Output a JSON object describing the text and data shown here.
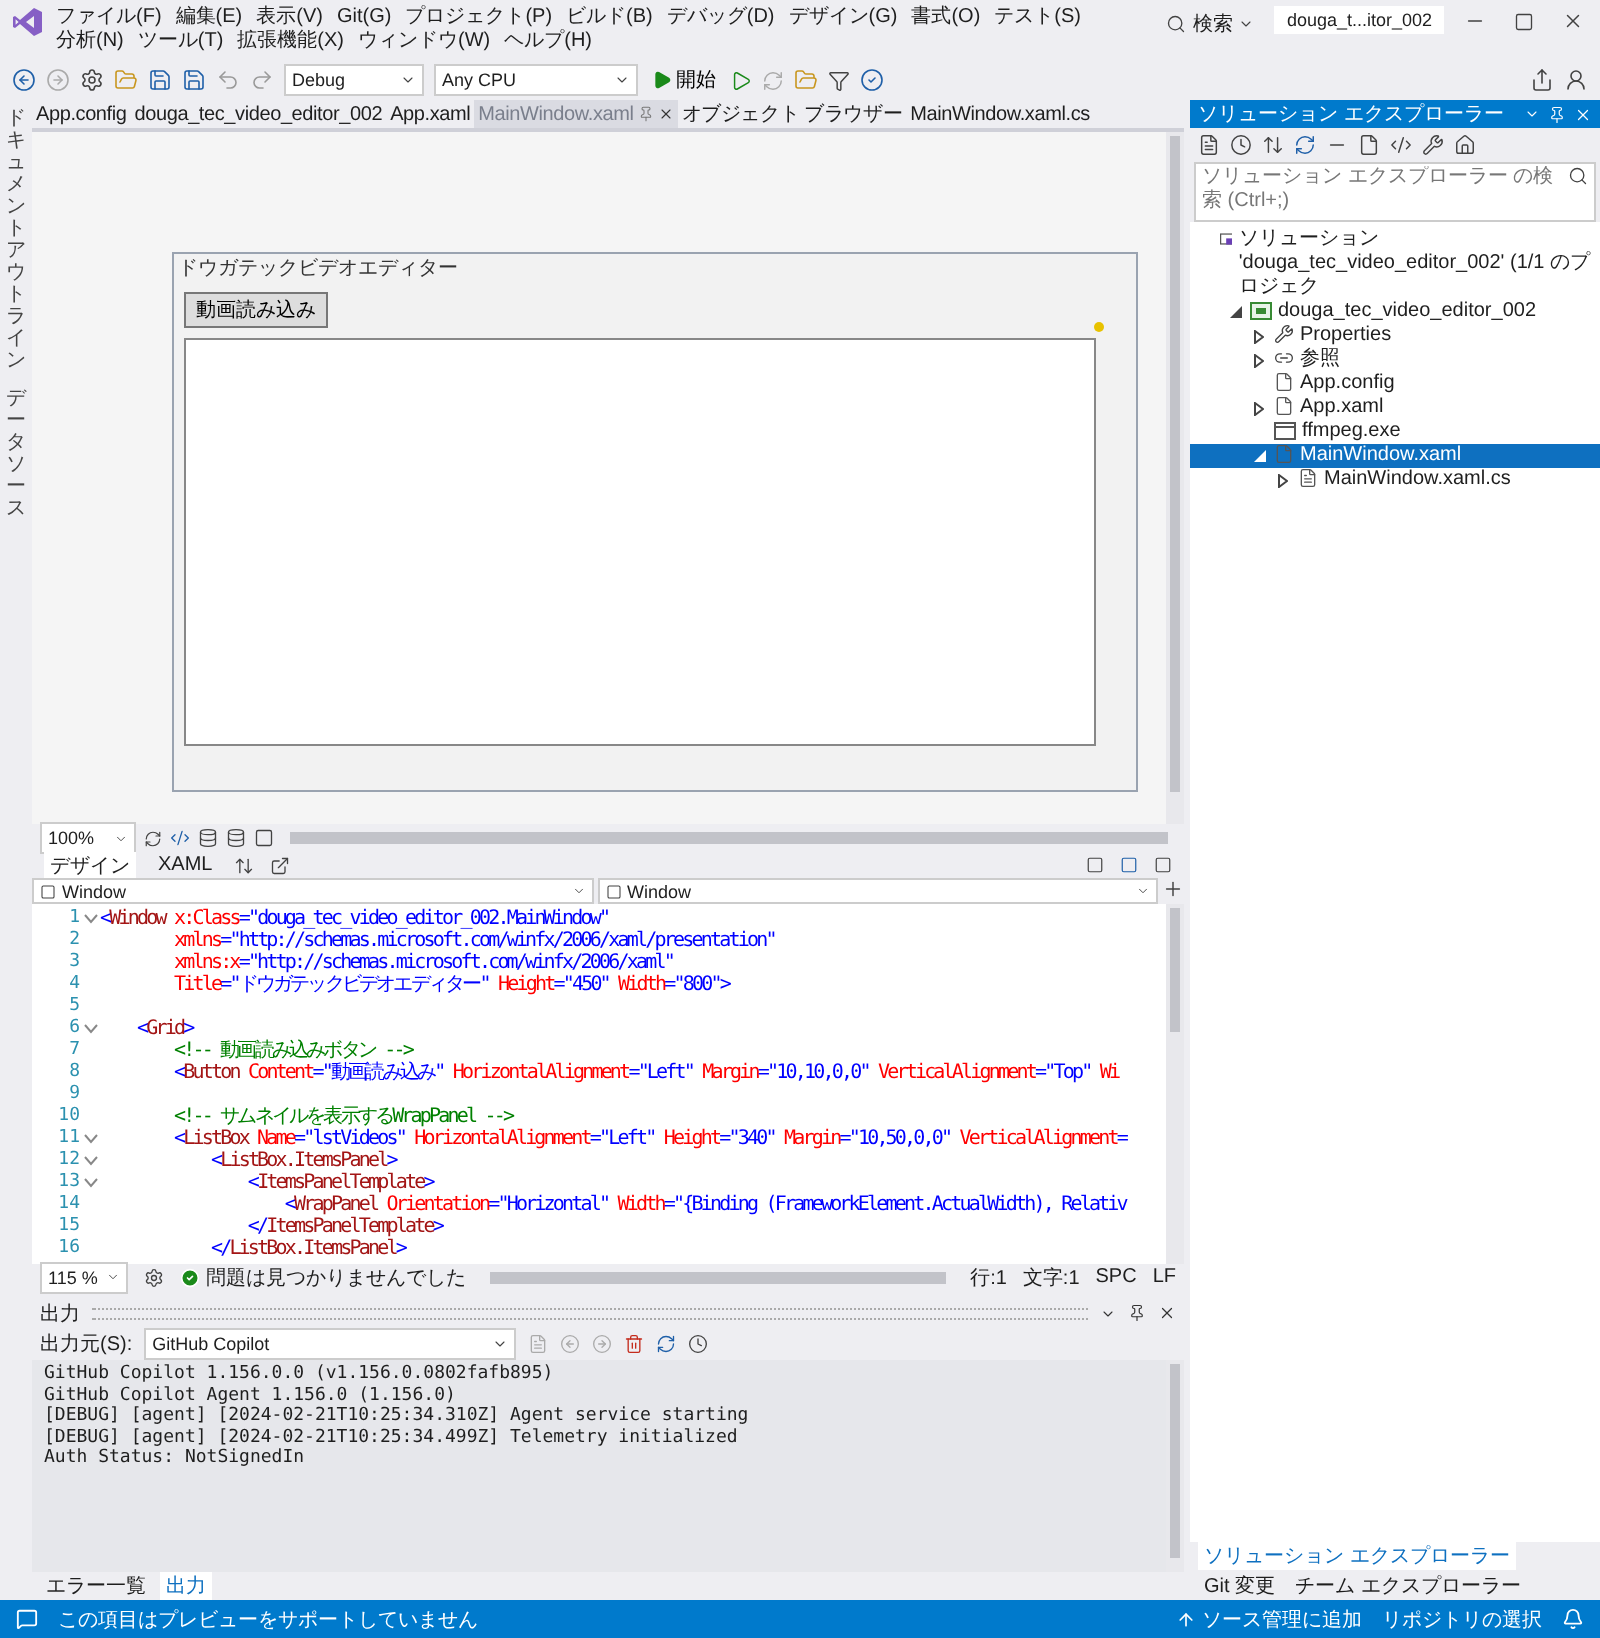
{
  "menu": [
    "ファイル(F)",
    "編集(E)",
    "表示(V)",
    "Git(G)",
    "プロジェクト(P)",
    "ビルド(B)",
    "デバッグ(D)",
    "デザイン(G)",
    "書式(O)",
    "テスト(S)",
    "分析(N)",
    "ツール(T)",
    "拡張機能(X)",
    "ウィンドウ(W)",
    "ヘルプ(H)"
  ],
  "search": {
    "label": "検索"
  },
  "title_badge": "douga_t...itor_002",
  "toolbar": {
    "configuration": "Debug",
    "platform": "Any CPU",
    "start": "開始"
  },
  "side_rail": [
    "ドキュメントアウトライン",
    "データソース"
  ],
  "document_tabs": [
    {
      "label": "App.config",
      "selected": false
    },
    {
      "label": "douga_tec_video_editor_002",
      "selected": false
    },
    {
      "label": "App.xaml",
      "selected": false
    },
    {
      "label": "MainWindow.xaml",
      "selected": true
    },
    {
      "label": "オブジェクト ブラウザー",
      "selected": false
    },
    {
      "label": "MainWindow.xaml.cs",
      "selected": false
    }
  ],
  "designer": {
    "window_title": "ドウガテックビデオエディター",
    "button": "動画読み込み",
    "zoom": "100%"
  },
  "view_tabs": [
    {
      "label": "デザイン",
      "selected": true
    },
    {
      "label": "XAML",
      "selected": false
    }
  ],
  "selectors": [
    "Window",
    "Window"
  ],
  "code_lines": [
    {
      "number": "1",
      "fold": true,
      "segments": [
        {
          "kind": "bracket",
          "text": "<"
        },
        {
          "kind": "tag",
          "text": "Window"
        },
        {
          "kind": "attr",
          "text": " x:Class"
        },
        {
          "kind": "bracket",
          "text": "="
        },
        {
          "kind": "value",
          "text": "\"douga_tec_video_editor_002.MainWindow\""
        }
      ]
    },
    {
      "number": "2",
      "fold": false,
      "segments": [
        {
          "kind": "attr",
          "text": "        xmlns"
        },
        {
          "kind": "bracket",
          "text": "="
        },
        {
          "kind": "value",
          "text": "\"http://schemas.microsoft.com/winfx/2006/xaml/presentation\""
        }
      ]
    },
    {
      "number": "3",
      "fold": false,
      "segments": [
        {
          "kind": "attr",
          "text": "        xmlns:x"
        },
        {
          "kind": "bracket",
          "text": "="
        },
        {
          "kind": "value",
          "text": "\"http://schemas.microsoft.com/winfx/2006/xaml\""
        }
      ]
    },
    {
      "number": "4",
      "fold": false,
      "segments": [
        {
          "kind": "attr",
          "text": "        Title"
        },
        {
          "kind": "bracket",
          "text": "="
        },
        {
          "kind": "value",
          "text": "\"ドウガテックビデオエディター\""
        },
        {
          "kind": "attr",
          "text": " Height"
        },
        {
          "kind": "bracket",
          "text": "="
        },
        {
          "kind": "value",
          "text": "\"450\""
        },
        {
          "kind": "attr",
          "text": " Width"
        },
        {
          "kind": "bracket",
          "text": "="
        },
        {
          "kind": "value",
          "text": "\"800\""
        },
        {
          "kind": "bracket",
          "text": ">"
        }
      ]
    },
    {
      "number": "5",
      "fold": false
    },
    {
      "number": "6",
      "fold": true,
      "segments": [
        {
          "kind": "bracket",
          "text": "    <"
        },
        {
          "kind": "tag",
          "text": "Grid"
        },
        {
          "kind": "bracket",
          "text": ">"
        }
      ]
    },
    {
      "number": "7",
      "fold": false,
      "segments": [
        {
          "kind": "comment",
          "text": "        <!-- 動画読み込みボタン -->"
        }
      ]
    },
    {
      "number": "8",
      "fold": false,
      "segments": [
        {
          "kind": "bracket",
          "text": "        <"
        },
        {
          "kind": "tag",
          "text": "Button"
        },
        {
          "kind": "attr",
          "text": " Content"
        },
        {
          "kind": "bracket",
          "text": "="
        },
        {
          "kind": "value",
          "text": "\"動画読み込み\""
        },
        {
          "kind": "attr",
          "text": " HorizontalAlignment"
        },
        {
          "kind": "bracket",
          "text": "="
        },
        {
          "kind": "value",
          "text": "\"Left\""
        },
        {
          "kind": "attr",
          "text": " Margin"
        },
        {
          "kind": "bracket",
          "text": "="
        },
        {
          "kind": "value",
          "text": "\"10,10,0,0\""
        },
        {
          "kind": "attr",
          "text": " VerticalAlignment"
        },
        {
          "kind": "bracket",
          "text": "="
        },
        {
          "kind": "value",
          "text": "\"Top\""
        },
        {
          "kind": "attr",
          "text": " Wi"
        }
      ]
    },
    {
      "number": "9",
      "fold": false
    },
    {
      "number": "10",
      "fold": false,
      "segments": [
        {
          "kind": "comment",
          "text": "        <!-- サムネイルを表示するWrapPanel -->"
        }
      ]
    },
    {
      "number": "11",
      "fold": true,
      "segments": [
        {
          "kind": "bracket",
          "text": "        <"
        },
        {
          "kind": "tag",
          "text": "ListBox"
        },
        {
          "kind": "attr",
          "text": " Name"
        },
        {
          "kind": "bracket",
          "text": "="
        },
        {
          "kind": "value",
          "text": "\"lstVideos\""
        },
        {
          "kind": "attr",
          "text": " HorizontalAlignment"
        },
        {
          "kind": "bracket",
          "text": "="
        },
        {
          "kind": "value",
          "text": "\"Left\""
        },
        {
          "kind": "attr",
          "text": " Height"
        },
        {
          "kind": "bracket",
          "text": "="
        },
        {
          "kind": "value",
          "text": "\"340\""
        },
        {
          "kind": "attr",
          "text": " Margin"
        },
        {
          "kind": "bracket",
          "text": "="
        },
        {
          "kind": "value",
          "text": "\"10,50,0,0\""
        },
        {
          "kind": "attr",
          "text": " VerticalAlignment"
        },
        {
          "kind": "bracket",
          "text": "="
        }
      ]
    },
    {
      "number": "12",
      "fold": true,
      "segments": [
        {
          "kind": "bracket",
          "text": "            <"
        },
        {
          "kind": "tag",
          "text": "ListBox.ItemsPanel"
        },
        {
          "kind": "bracket",
          "text": ">"
        }
      ]
    },
    {
      "number": "13",
      "fold": true,
      "segments": [
        {
          "kind": "bracket",
          "text": "                <"
        },
        {
          "kind": "tag",
          "text": "ItemsPanelTemplate"
        },
        {
          "kind": "bracket",
          "text": ">"
        }
      ]
    },
    {
      "number": "14",
      "fold": false,
      "segments": [
        {
          "kind": "bracket",
          "text": "                    <"
        },
        {
          "kind": "tag",
          "text": "WrapPanel"
        },
        {
          "kind": "attr",
          "text": " Orientation"
        },
        {
          "kind": "bracket",
          "text": "="
        },
        {
          "kind": "value",
          "text": "\"Horizontal\""
        },
        {
          "kind": "attr",
          "text": " Width"
        },
        {
          "kind": "bracket",
          "text": "="
        },
        {
          "kind": "value",
          "text": "\"{Binding (FrameworkElement.ActualWidth), Relativ"
        }
      ]
    },
    {
      "number": "15",
      "fold": false,
      "segments": [
        {
          "kind": "bracket",
          "text": "                </"
        },
        {
          "kind": "tag",
          "text": "ItemsPanelTemplate"
        },
        {
          "kind": "bracket",
          "text": ">"
        }
      ]
    },
    {
      "number": "16",
      "fold": false,
      "segments": [
        {
          "kind": "bracket",
          "text": "            </"
        },
        {
          "kind": "tag",
          "text": "ListBox.ItemsPanel"
        },
        {
          "kind": "bracket",
          "text": ">"
        }
      ]
    }
  ],
  "editor_status": {
    "zoom": "115 %",
    "issues": "問題は見つかりませんでした",
    "line": "行:1",
    "char": "文字:1",
    "spaces": "SPC",
    "line_ending": "LF"
  },
  "output": {
    "title": "出力",
    "source_label": "出力元(S):",
    "source": "GitHub Copilot",
    "lines": [
      "GitHub Copilot 1.156.0.0 (v1.156.0.0802fafb895)",
      "GitHub Copilot Agent 1.156.0 (1.156.0)",
      "[DEBUG] [agent] [2024-02-21T10:25:34.310Z] Agent service starting",
      "[DEBUG] [agent] [2024-02-21T10:25:34.499Z] Telemetry initialized",
      "Auth Status: NotSignedIn"
    ]
  },
  "bottom_tabs_left": [
    {
      "label": "エラー一覧",
      "selected": false
    },
    {
      "label": "出力",
      "selected": true
    }
  ],
  "solution_explorer": {
    "title": "ソリューション エクスプローラー",
    "search_placeholder": "ソリューション エクスプローラー の検索 (Ctrl+;)",
    "tree": [
      {
        "kind": "solution",
        "label": "ソリューション 'douga_tec_video_editor_002' (1/1 のプロジェク",
        "selected": false,
        "children": [
          {
            "kind": "project",
            "label": "douga_tec_video_editor_002",
            "selected": false,
            "expanded": true,
            "children": [
              {
                "kind": "properties",
                "label": "Properties",
                "selected": false,
                "expanded": false
              },
              {
                "kind": "references",
                "label": "参照",
                "selected": false,
                "expanded": false
              },
              {
                "kind": "file",
                "label": "App.config",
                "selected": false
              },
              {
                "kind": "file",
                "label": "App.xaml",
                "selected": false,
                "expanded": false
              },
              {
                "kind": "exe",
                "label": "ffmpeg.exe",
                "selected": false
              },
              {
                "kind": "file",
                "label": "MainWindow.xaml",
                "selected": true,
                "expanded": true,
                "children": [
                  {
                    "kind": "code",
                    "label": "MainWindow.xaml.cs",
                    "selected": false,
                    "expanded": false
                  }
                ]
              }
            ]
          }
        ]
      }
    ]
  },
  "bottom_tabs_right": [
    {
      "label": "ソリューション エクスプローラー",
      "selected": true
    },
    {
      "label": "Git 変更",
      "selected": false
    },
    {
      "label": "チーム エクスプローラー",
      "selected": false
    }
  ],
  "status_bar": {
    "message": "この項目はプレビューをサポートしていません",
    "source_control": "ソース管理に追加",
    "repository": "リポジトリの選択"
  }
}
